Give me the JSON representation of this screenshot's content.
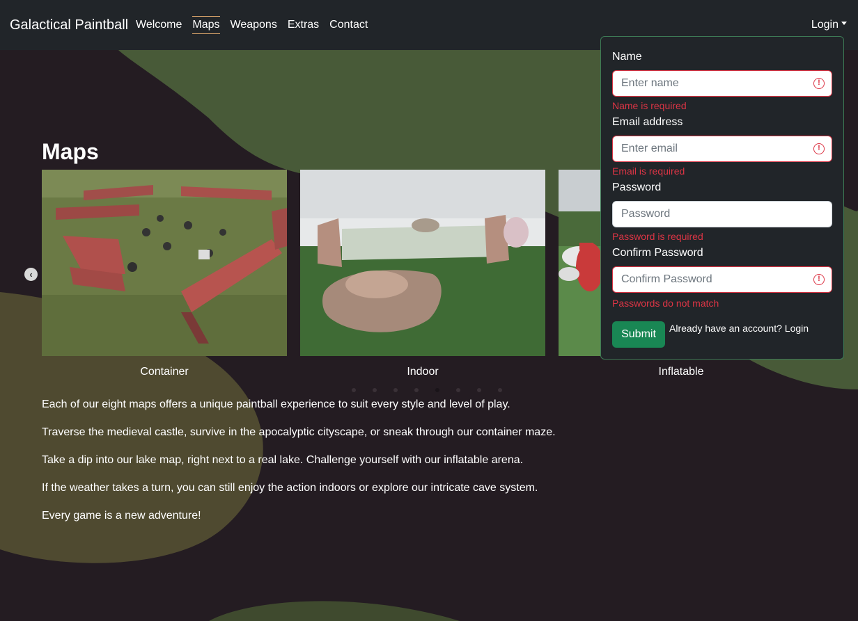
{
  "navbar": {
    "brand": "Galactical Paintball",
    "links": [
      {
        "label": "Welcome"
      },
      {
        "label": "Maps"
      },
      {
        "label": "Weapons"
      },
      {
        "label": "Extras"
      },
      {
        "label": "Contact"
      }
    ],
    "active_link": "Maps",
    "login_label": "Login"
  },
  "main": {
    "title": "Maps",
    "cards": [
      {
        "caption": "Container"
      },
      {
        "caption": "Indoor"
      },
      {
        "caption": "Inflatable"
      }
    ],
    "paragraphs": [
      "Each of our eight maps offers a unique paintball experience to suit every style and level of play.",
      "Traverse the medieval castle, survive in the apocalyptic cityscape, or sneak through our container maze.",
      "Take a dip into our lake map, right next to a real lake. Challenge yourself with our inflatable arena.",
      "If the weather takes a turn, you can still enjoy the action indoors or explore our intricate cave system.",
      "Every game is a new adventure!"
    ],
    "carousel_active_index": 4,
    "carousel_count": 8
  },
  "form": {
    "name": {
      "label": "Name",
      "placeholder": "Enter name",
      "value": "",
      "error": "Name is required"
    },
    "email": {
      "label": "Email address",
      "placeholder": "Enter email",
      "value": "",
      "error": "Email is required"
    },
    "password": {
      "label": "Password",
      "placeholder": "Password",
      "value": "",
      "error": "Password is required"
    },
    "confirm": {
      "label": "Confirm Password",
      "placeholder": "Confirm Password",
      "value": "",
      "error": "Passwords do not match"
    },
    "submit_label": "Submit",
    "login_prompt": "Already have an account? Login"
  },
  "colors": {
    "background": "#241c22",
    "navbar": "#212529",
    "accent_green": "#198754",
    "error_red": "#dc3545",
    "blob_green": "#485a38",
    "blob_olive": "#4f4a30"
  }
}
